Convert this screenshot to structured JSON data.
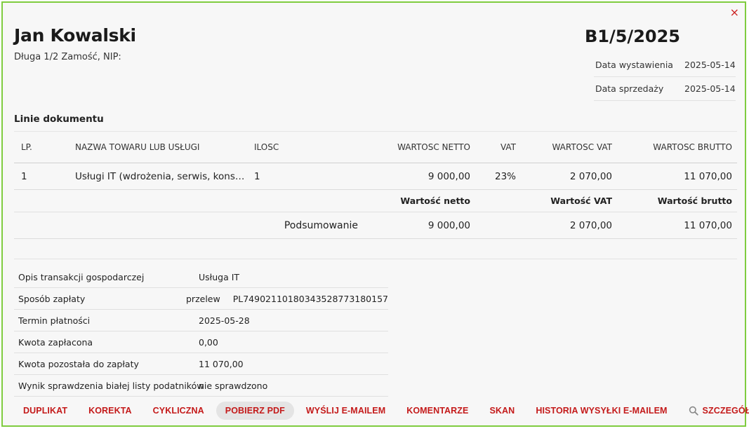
{
  "close_label": "×",
  "client": {
    "name": "Jan Kowalski",
    "address": "Długa 1/2 Zamość, NIP:"
  },
  "document": {
    "number": "B1/5/2025",
    "dates": [
      {
        "label": "Data wystawienia",
        "value": "2025-05-14"
      },
      {
        "label": "Data sprzedaży",
        "value": "2025-05-14"
      }
    ]
  },
  "lines": {
    "title": "Linie dokumentu",
    "headers": {
      "lp": "LP.",
      "name": "NAZWA TOWARU LUB USŁUGI",
      "qty": "ILOSC",
      "net": "WARTOSC NETTO",
      "vat": "VAT",
      "vat_value": "WARTOSC VAT",
      "gross": "WARTOSC BRUTTO"
    },
    "rows": [
      {
        "lp": "1",
        "name": "Usługi IT (wdrożenia, serwis, kons…",
        "qty": "1",
        "net": "9 000,00",
        "vat": "23%",
        "vat_value": "2 070,00",
        "gross": "11 070,00"
      }
    ]
  },
  "summary": {
    "headers": {
      "net": "Wartość netto",
      "vat": "Wartość VAT",
      "gross": "Wartość brutto"
    },
    "label": "Podsumowanie",
    "net": "9 000,00",
    "vat": "2 070,00",
    "gross": "11 070,00"
  },
  "info": {
    "transaction_desc": {
      "label": "Opis transakcji gospodarczej",
      "value": "Usługa IT"
    },
    "payment_method": {
      "label": "Sposób zapłaty",
      "value": "przelew",
      "iban": "PL74902110180343528773180157"
    },
    "payment_due": {
      "label": "Termin płatności",
      "value": "2025-05-28"
    },
    "amount_paid": {
      "label": "Kwota zapłacona",
      "value": "0,00"
    },
    "amount_left": {
      "label": "Kwota pozostała do zapłaty",
      "value": "11 070,00"
    },
    "whitelist": {
      "label": "Wynik sprawdzenia białej listy podatników",
      "value": "nie sprawdzono"
    }
  },
  "actions": {
    "duplicate": "DUPLIKAT",
    "correction": "KOREKTA",
    "recurring": "CYKLICZNA",
    "download_pdf": "POBIERZ PDF",
    "send_email": "WYŚLIJ E-MAILEM",
    "comments": "KOMENTARZE",
    "scan": "SKAN",
    "email_history": "HISTORIA WYSYŁKI E-MAILEM",
    "details": "SZCZEGÓŁY"
  },
  "colors": {
    "border": "#7fcc3f",
    "action_red": "#c41a1a",
    "close_red": "#cc2222"
  }
}
